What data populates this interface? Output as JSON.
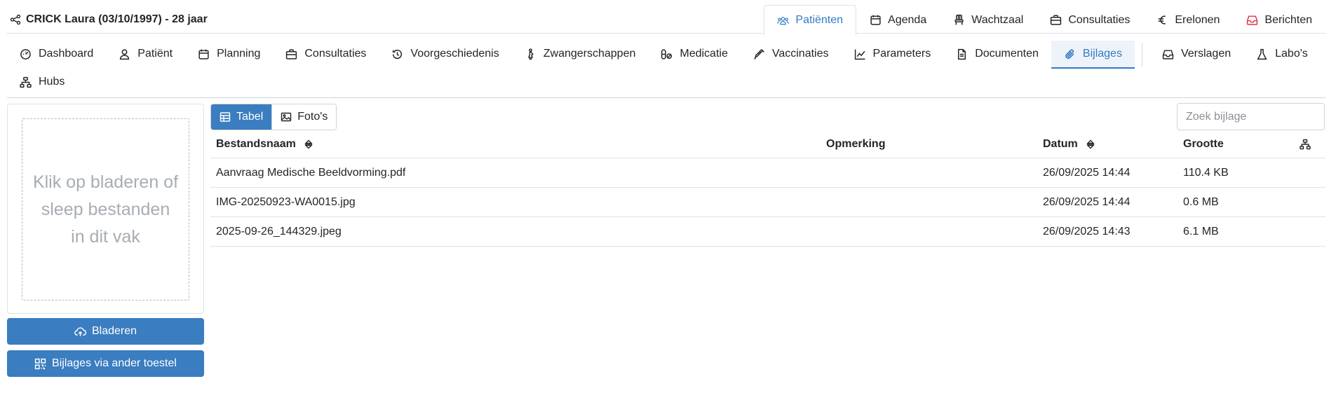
{
  "patient": {
    "title": "CRICK Laura (03/10/1997) - 28 jaar",
    "icon": "share-nodes-icon"
  },
  "main_nav": [
    {
      "label": "Patiënten",
      "icon": "users-icon",
      "active": true
    },
    {
      "label": "Agenda",
      "icon": "calendar-icon"
    },
    {
      "label": "Wachtzaal",
      "icon": "chair-icon"
    },
    {
      "label": "Consultaties",
      "icon": "briefcase-medical-icon"
    },
    {
      "label": "Erelonen",
      "icon": "euro-icon"
    },
    {
      "label": "Berichten",
      "icon": "inbox-icon"
    }
  ],
  "sub_nav": [
    {
      "label": "Dashboard",
      "icon": "gauge-icon"
    },
    {
      "label": "Patiënt",
      "icon": "user-icon"
    },
    {
      "label": "Planning",
      "icon": "calendar-icon"
    },
    {
      "label": "Consultaties",
      "icon": "briefcase-medical-icon"
    },
    {
      "label": "Voorgeschiedenis",
      "icon": "history-icon"
    },
    {
      "label": "Zwangerschappen",
      "icon": "pregnant-icon"
    },
    {
      "label": "Medicatie",
      "icon": "pills-icon"
    },
    {
      "label": "Vaccinaties",
      "icon": "syringe-icon"
    },
    {
      "label": "Parameters",
      "icon": "chart-line-icon"
    },
    {
      "label": "Documenten",
      "icon": "file-icon"
    },
    {
      "label": "Bijlages",
      "icon": "paperclip-icon",
      "active": true
    },
    {
      "label": "Verslagen",
      "icon": "inbox-icon"
    },
    {
      "label": "Labo's",
      "icon": "flask-icon"
    },
    {
      "label": "Hubs",
      "icon": "sitemap-icon"
    }
  ],
  "upload": {
    "dropzone_text": "Klik op bladeren of sleep bestanden in dit vak",
    "browse_label": "Bladeren",
    "device_label": "Bijlages via ander toestel"
  },
  "view_toggle": {
    "table_label": "Tabel",
    "photos_label": "Foto's",
    "active": "table"
  },
  "search": {
    "placeholder": "Zoek bijlage",
    "value": ""
  },
  "table": {
    "columns": {
      "name": "Bestandsnaam",
      "note": "Opmerking",
      "date": "Datum",
      "size": "Grootte"
    },
    "rows": [
      {
        "name": "Aanvraag Medische Beeldvorming.pdf",
        "note": "",
        "date": "26/09/2025 14:44",
        "size": "110.4 KB"
      },
      {
        "name": "IMG-20250923-WA0015.jpg",
        "note": "",
        "date": "26/09/2025 14:44",
        "size": "0.6 MB"
      },
      {
        "name": "2025-09-26_144329.jpeg",
        "note": "",
        "date": "26/09/2025 14:43",
        "size": "6.1 MB"
      }
    ]
  },
  "colors": {
    "accent": "#2f7bc4",
    "button": "#3a7dc0",
    "border": "#dee2e6",
    "danger": "#dc3545"
  }
}
